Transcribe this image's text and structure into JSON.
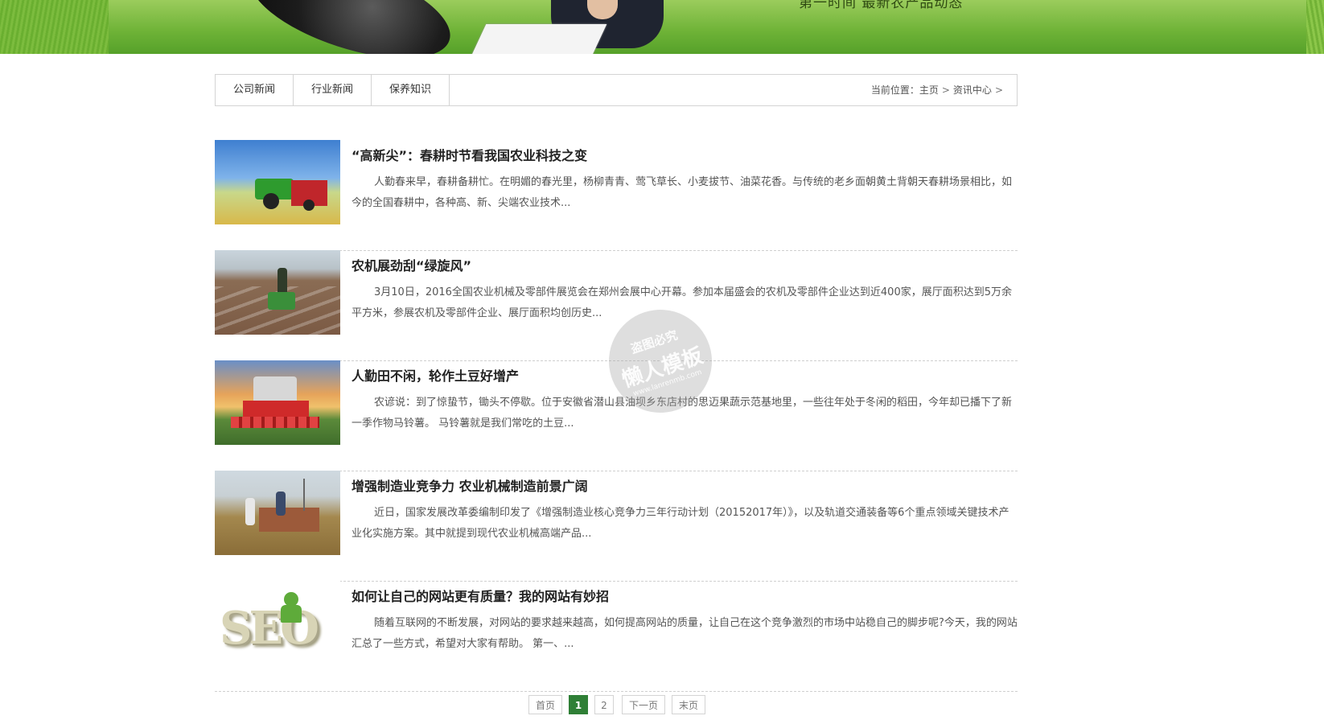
{
  "banner": {
    "slogan": "第一时间 最新农产品动态"
  },
  "tabs": [
    {
      "label": "公司新闻"
    },
    {
      "label": "行业新闻"
    },
    {
      "label": "保养知识"
    }
  ],
  "breadcrumb": {
    "prefix": "当前位置：",
    "home": "主页",
    "current": "资讯中心",
    "separator": ">"
  },
  "news": [
    {
      "title": "“高新尖”：春耕时节看我国农业科技之变",
      "summary": "人勤春来早，春耕备耕忙。在明媚的春光里，杨柳青青、莺飞草长、小麦拔节、油菜花香。与传统的老乡面朝黄土背朝天春耕场景相比，如今的全国春耕中，各种高、新、尖端农业技术..."
    },
    {
      "title": "农机展劲刮“绿旋风”",
      "summary": "3月10日，2016全国农业机械及零部件展览会在郑州会展中心开幕。参加本届盛会的农机及零部件企业达到近400家，展厅面积达到5万余平方米，参展农机及零部件企业、展厅面积均创历史..."
    },
    {
      "title": "人勤田不闲，轮作土豆好增产",
      "summary": "农谚说：到了惊蛰节，锄头不停歇。位于安徽省潜山县油坝乡东店村的思迈果蔬示范基地里，一些往年处于冬闲的稻田，今年却已播下了新一季作物马铃薯。 马铃薯就是我们常吃的土豆..."
    },
    {
      "title": "增强制造业竞争力 农业机械制造前景广阔",
      "summary": "近日，国家发展改革委编制印发了《增强制造业核心竞争力三年行动计划（20152017年）》，以及轨道交通装备等6个重点领域关键技术产业化实施方案。其中就提到现代农业机械高端产品..."
    },
    {
      "title": "如何让自己的网站更有质量？我的网站有妙招",
      "summary": "随着互联网的不断发展，对网站的要求越来越高，如何提高网站的质量，让自己在这个竞争激烈的市场中站稳自己的脚步呢?今天，我的网站汇总了一些方式，希望对大家有帮助。 第一、..."
    }
  ],
  "seo_image_text": "SEO",
  "watermark": {
    "line1": "盗图必究",
    "line2": "懒人模板",
    "line3": "www.lanrenmb.com"
  },
  "pagination": {
    "first": "首页",
    "pages": [
      "1",
      "2"
    ],
    "current": "1",
    "next": "下一页",
    "last": "末页"
  }
}
